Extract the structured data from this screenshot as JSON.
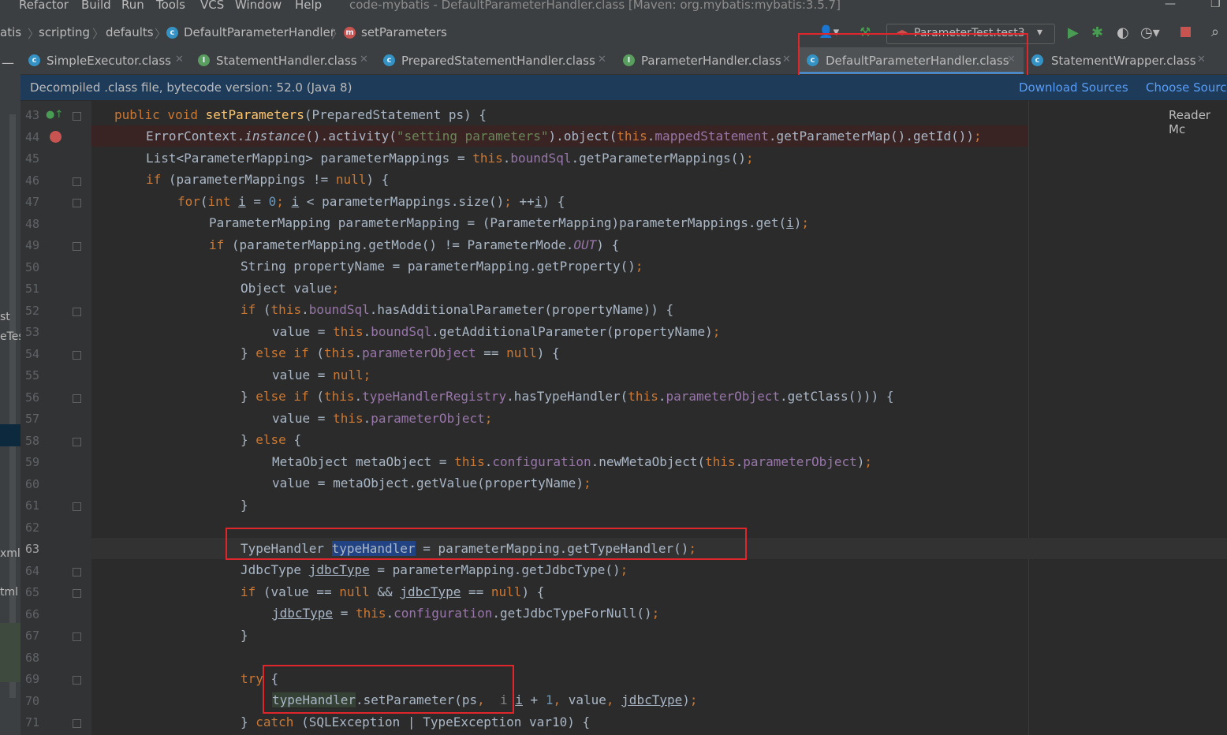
{
  "menu": {
    "items": [
      "Refactor",
      "Build",
      "Run",
      "Tools",
      "VCS",
      "Window",
      "Help"
    ],
    "title": "code-mybatis - DefaultParameterHandler.class [Maven: org.mybatis:mybatis:3.5.7]"
  },
  "nav": {
    "crumbs": [
      "atis",
      "scripting",
      "defaults",
      "DefaultParameterHandler",
      "setParameters"
    ]
  },
  "toolbar": {
    "run_config": "ParameterTest.test3"
  },
  "tabs": [
    "SimpleExecutor.class",
    "StatementHandler.class",
    "PreparedStatementHandler.class",
    "ParameterHandler.class",
    "DefaultParameterHandler.class",
    "StatementWrapper.class"
  ],
  "info": {
    "message": "Decompiled .class file, bytecode version: 52.0 (Java 8)",
    "download": "Download Sources",
    "choose": "Choose Sourc"
  },
  "reader_mode": "Reader Mc",
  "left_labels": [
    "st",
    "eTes",
    "xml",
    "tml"
  ],
  "line_numbers": [
    "43",
    "44",
    "45",
    "46",
    "47",
    "48",
    "49",
    "50",
    "51",
    "52",
    "53",
    "54",
    "55",
    "56",
    "57",
    "58",
    "59",
    "60",
    "61",
    "62",
    "63",
    "64",
    "65",
    "66",
    "67",
    "68",
    "69",
    "70",
    "71"
  ],
  "colors": {
    "accent": "#4a88c7",
    "highlight_box": "#e0262d",
    "breakpoint": "#c75450"
  }
}
